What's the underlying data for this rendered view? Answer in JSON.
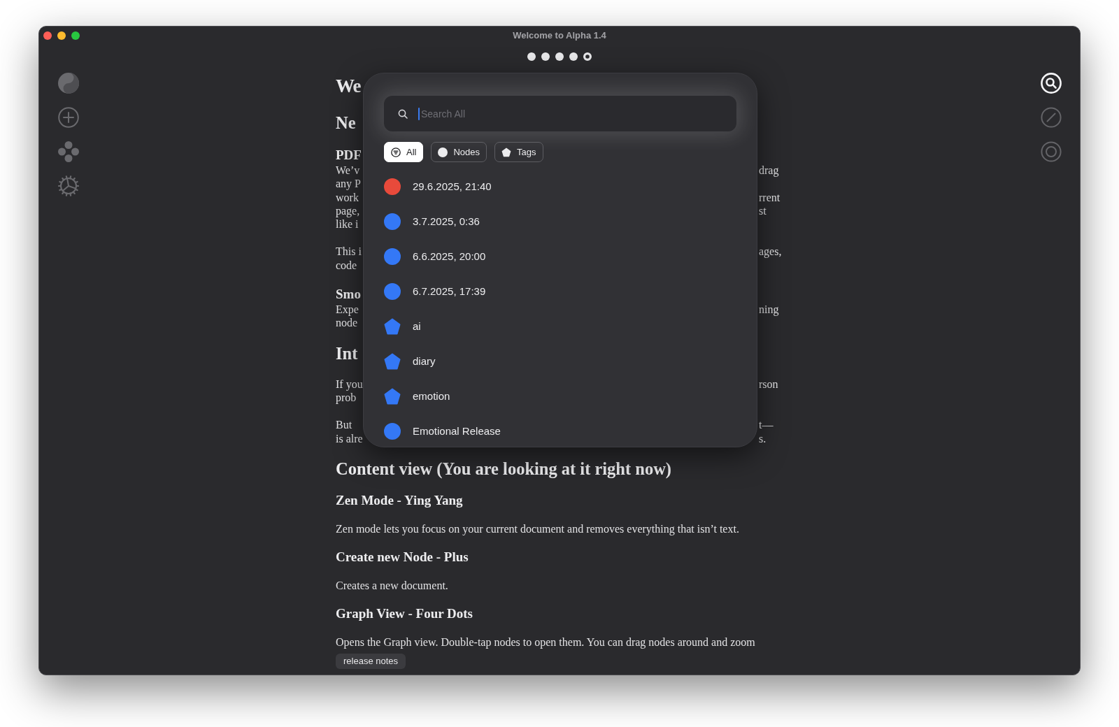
{
  "window": {
    "title": "Welcome to Alpha 1.4"
  },
  "page_dots": [
    {
      "selected": false
    },
    {
      "selected": false
    },
    {
      "selected": false
    },
    {
      "selected": false
    },
    {
      "selected": true
    }
  ],
  "document": [
    {
      "kind": "h1",
      "lines": [
        {
          "left": "We"
        }
      ]
    },
    {
      "kind": "h2",
      "lines": [
        {
          "left": "Ne"
        }
      ]
    },
    {
      "kind": "p",
      "heading": {
        "left": "PDF"
      },
      "lines": [
        {
          "left": "We’v",
          "right": "drag"
        },
        {
          "left": "any P"
        },
        {
          "left": "work",
          "right": "rrent"
        },
        {
          "left": "page,",
          "right": "st"
        },
        {
          "left": "like i"
        }
      ]
    },
    {
      "kind": "p",
      "lines": [
        {
          "left": "This i",
          "right": "ages,"
        },
        {
          "left": "code"
        }
      ]
    },
    {
      "kind": "p",
      "heading": {
        "left": "Smo"
      },
      "lines": [
        {
          "left": "Expe",
          "right": "ning"
        },
        {
          "left": "node"
        }
      ]
    },
    {
      "kind": "h2",
      "lines": [
        {
          "left": "Int"
        }
      ]
    },
    {
      "kind": "p",
      "lines": [
        {
          "left": "If you",
          "right": "rson"
        },
        {
          "left": "prob"
        }
      ]
    },
    {
      "kind": "p",
      "lines": [
        {
          "left": "But",
          "right": "t—"
        },
        {
          "left": "is alre",
          "right": "s."
        }
      ]
    },
    {
      "kind": "h2",
      "lines": [
        {
          "text": "Content view (You are looking at it right now)"
        }
      ]
    },
    {
      "kind": "h3",
      "lines": [
        {
          "text": "Zen Mode - Ying Yang"
        }
      ]
    },
    {
      "kind": "p",
      "lines": [
        {
          "text": "Zen mode lets you focus on your current document and removes everything that isn’t text."
        }
      ]
    },
    {
      "kind": "h3",
      "lines": [
        {
          "text": "Create new Node - Plus"
        }
      ]
    },
    {
      "kind": "p",
      "lines": [
        {
          "text": "Creates a new document."
        }
      ]
    },
    {
      "kind": "h3",
      "lines": [
        {
          "text": "Graph View - Four Dots"
        }
      ]
    },
    {
      "kind": "p",
      "lines": [
        {
          "text": "Opens the Graph view. Double-tap nodes to open them. You can drag nodes around and zoom"
        }
      ]
    }
  ],
  "release_notes_button": {
    "label": "release notes"
  },
  "right_toolbar": [
    {
      "selected": true
    },
    {
      "selected": false
    },
    {
      "selected": false
    }
  ],
  "search_popup": {
    "search": {
      "placeholder": "Search All",
      "focused": true
    },
    "filters": [
      {
        "label": "All",
        "selected": true
      },
      {
        "label": "Nodes",
        "selected": false
      },
      {
        "label": "Tags",
        "selected": false
      }
    ],
    "results": [
      {
        "label": "29.6.2025, 21:40",
        "kind": "node",
        "color": "#e84a3b"
      },
      {
        "label": "3.7.2025, 0:36",
        "kind": "node",
        "color": "#3478f6"
      },
      {
        "label": "6.6.2025, 20:00",
        "kind": "node",
        "color": "#3478f6"
      },
      {
        "label": "6.7.2025, 17:39",
        "kind": "node",
        "color": "#3478f6"
      },
      {
        "label": "ai",
        "kind": "tag",
        "color": "#3478f6"
      },
      {
        "label": "diary",
        "kind": "tag",
        "color": "#3478f6"
      },
      {
        "label": "emotion",
        "kind": "tag",
        "color": "#3478f6"
      },
      {
        "label": "Emotional Release",
        "kind": "node",
        "color": "#3478f6"
      }
    ]
  }
}
